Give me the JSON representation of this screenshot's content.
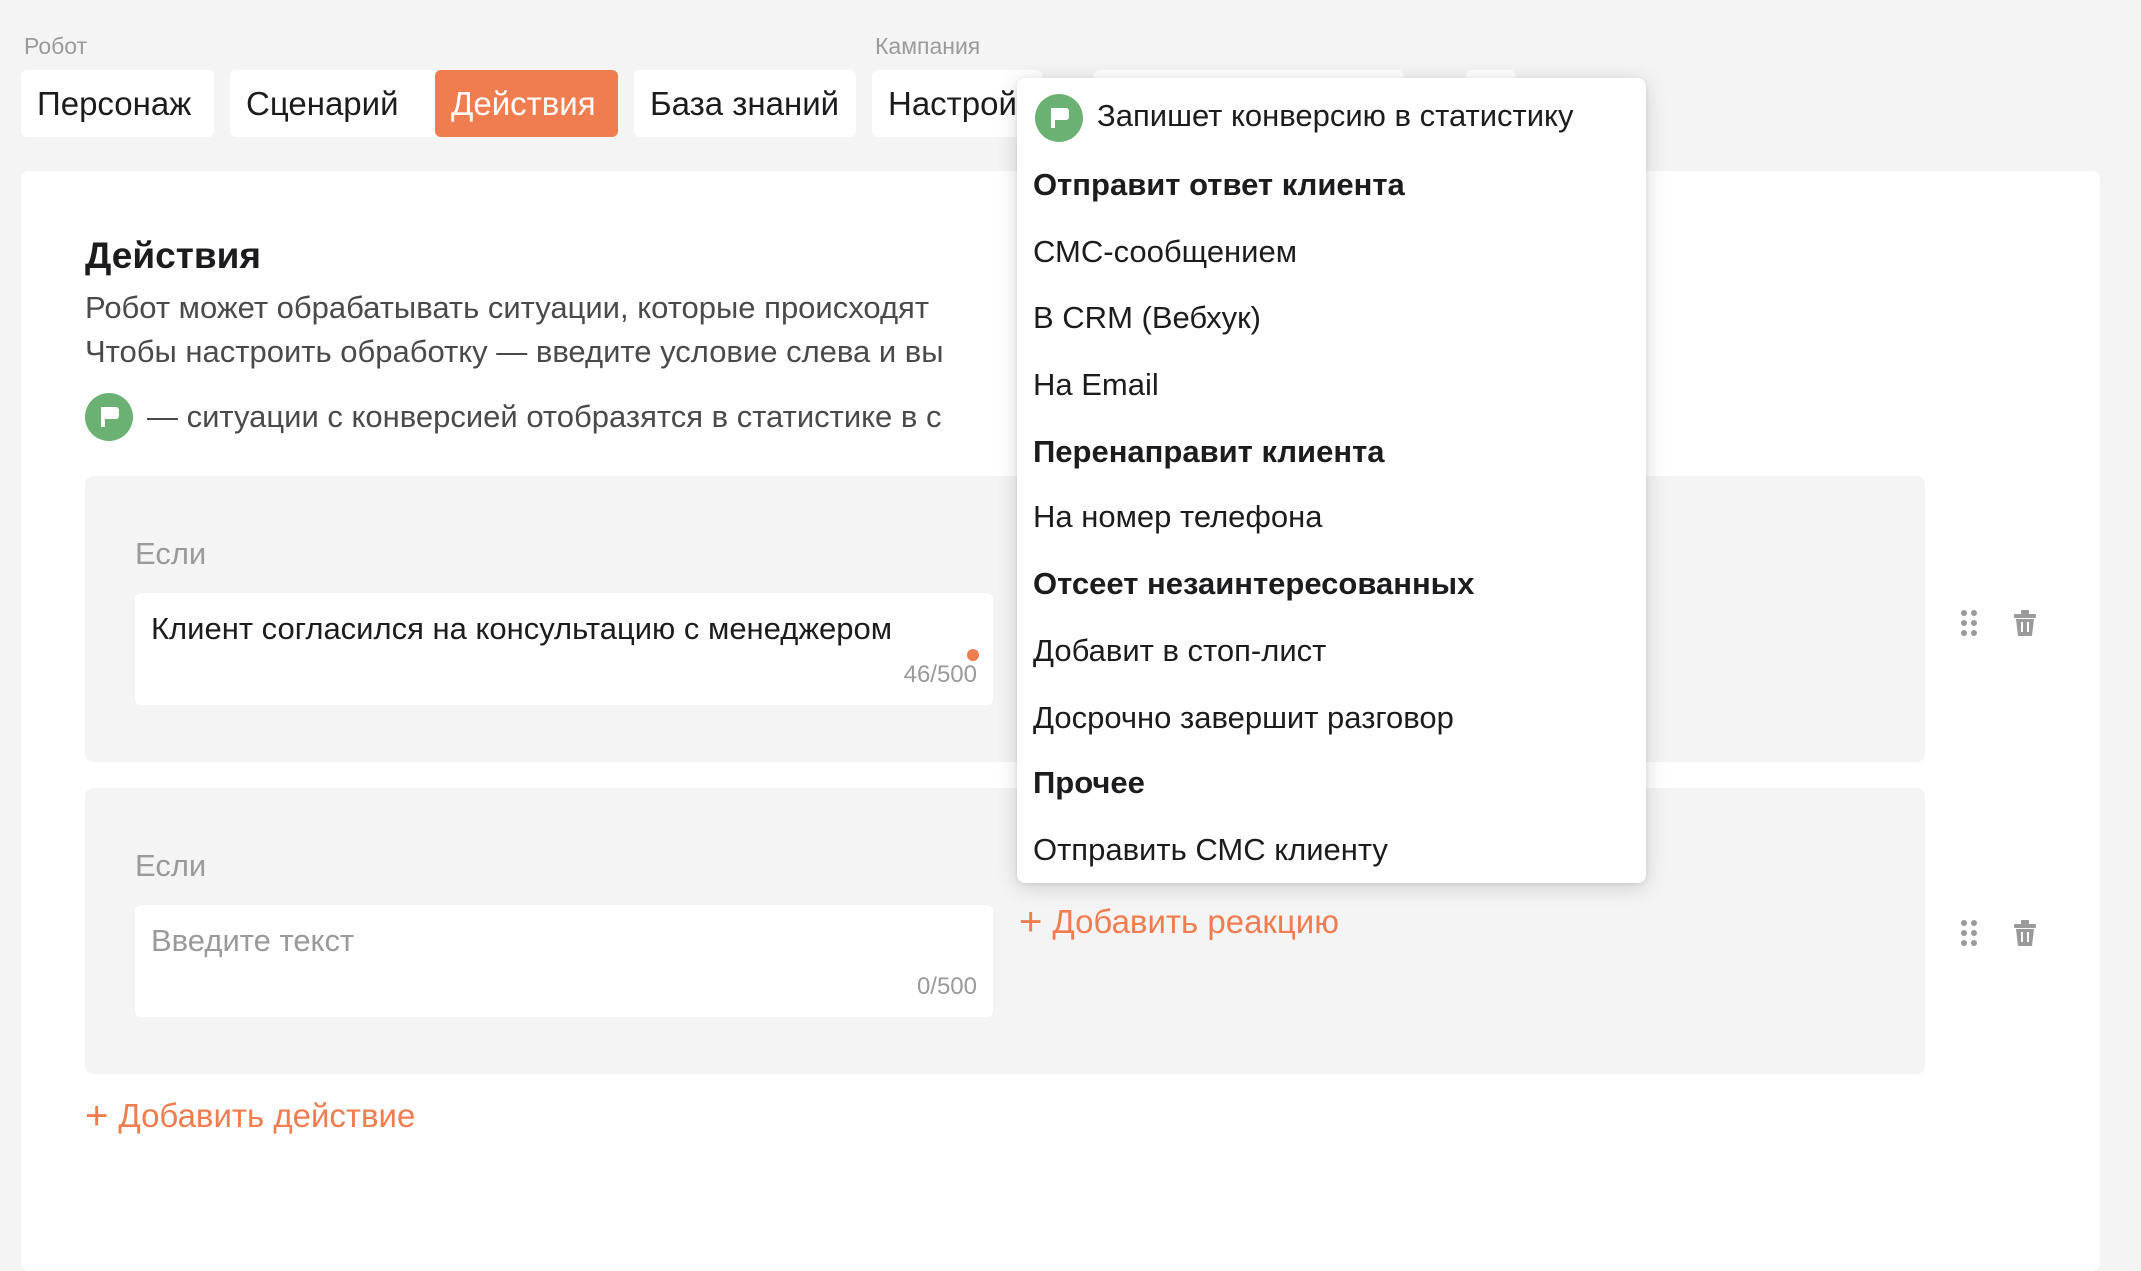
{
  "groups": {
    "robot": "Робот",
    "campaign": "Кампания"
  },
  "tabs": {
    "persona": "Персонаж",
    "scenario": "Сценарий",
    "actions": "Действия",
    "knowledge": "База знаний",
    "settings": "Настройки"
  },
  "section": {
    "title": "Действия",
    "line1": "Робот может обрабатывать ситуации, которые происходят",
    "line2": "Чтобы настроить обработку — введите условие слева и вы",
    "conversion_note": "— ситуации с конверсией отобразятся в статистике в с"
  },
  "actions": [
    {
      "if_label": "Если",
      "text": "Клиент согласился на консультацию с менеджером",
      "counter": "46/500"
    },
    {
      "if_label": "Если",
      "placeholder": "Введите текст",
      "counter": "0/500",
      "add_reaction": "Добавить реакцию"
    }
  ],
  "add_action": "Добавить действие",
  "dropdown": {
    "conversion": "Запишет конверсию в статистику",
    "h_send": "Отправит ответ клиента",
    "sms": "СМС-сообщением",
    "crm": "В CRM (Вебхук)",
    "email": "На Email",
    "h_redirect": "Перенаправит клиента",
    "phone": "На номер телефона",
    "h_filter": "Отсеет незаинтересованных",
    "stoplist": "Добавит в стоп-лист",
    "end_call": "Досрочно завершит разговор",
    "h_other": "Прочее",
    "send_sms": "Отправить СМС клиенту"
  },
  "colors": {
    "accent": "#ef7d50",
    "conversion": "#6ab173"
  },
  "icons": [
    "flag-icon",
    "plus-icon",
    "drag-handle-icon",
    "trash-icon"
  ]
}
